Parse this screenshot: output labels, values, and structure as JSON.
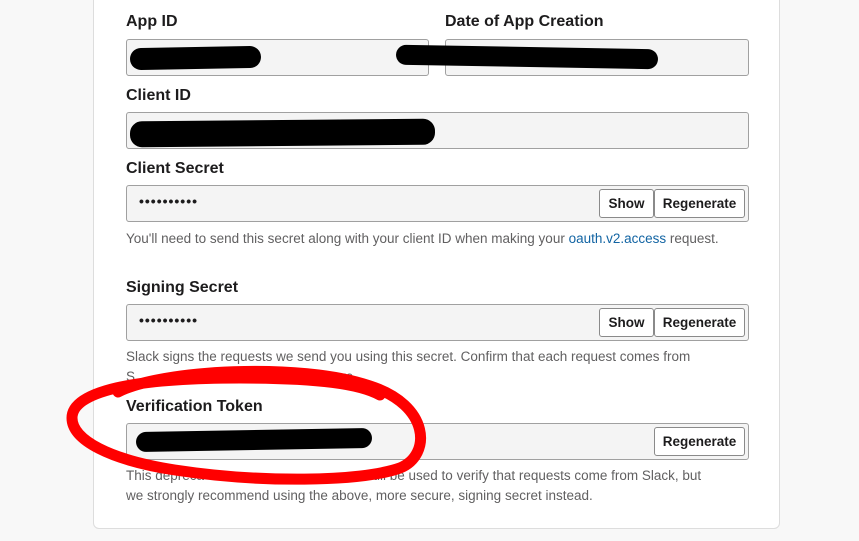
{
  "fields": {
    "app_id": {
      "label": "App ID"
    },
    "date_created": {
      "label": "Date of App Creation"
    },
    "client_id": {
      "label": "Client ID"
    },
    "client_secret": {
      "label": "Client Secret",
      "masked_value": "••••••••••",
      "show_label": "Show",
      "regenerate_label": "Regenerate",
      "help_before_link": "You'll need to send this secret along with your client ID when making your ",
      "help_link": "oauth.v2.access",
      "help_after_link": " request."
    },
    "signing_secret": {
      "label": "Signing Secret",
      "masked_value": "••••••••••",
      "show_label": "Show",
      "regenerate_label": "Regenerate",
      "help_line1": "Slack signs the requests we send you using this secret. Confirm that each request comes from",
      "help_line2_visible": "S                                                    ture."
    },
    "verification_token": {
      "label": "Verification Token",
      "regenerate_label": "Regenerate",
      "help_line1_start": "This depreca",
      "help_line1_end": "can still be used to verify that requests come from Slack, but",
      "help_line2": "we strongly recommend using the above, more secure, signing secret instead."
    }
  },
  "annotation": {
    "color": "#ff0000"
  },
  "redaction": {
    "color": "#000000"
  }
}
